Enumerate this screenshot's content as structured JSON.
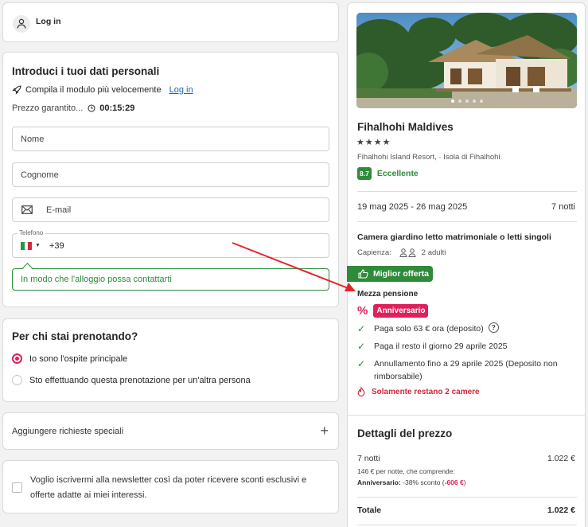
{
  "login": {
    "label": "Log in"
  },
  "personal": {
    "title": "Introduci i tuoi dati personali",
    "fast_text": "Compila il modulo più velocemente",
    "fast_link": "Log in",
    "guarantee_text": "Prezzo garantito...",
    "timer": "00:15:29",
    "name_placeholder": "Nome",
    "surname_placeholder": "Cognome",
    "email_placeholder": "E-mail",
    "phone_label": "Telefono",
    "phone_prefix": "+39",
    "phone_hint": "In modo che l'alloggio possa contattarti"
  },
  "booking_for": {
    "title": "Per chi stai prenotando?",
    "option_main": "Io sono l'ospite principale",
    "option_other": "Sto effettuando questa prenotazione per un'altra persona"
  },
  "special_requests": {
    "label": "Aggiungere richieste speciali"
  },
  "newsletter": {
    "text": "Voglio iscrivermi alla newsletter così da poter ricevere sconti esclusivi e offerte adatte ai miei interessi."
  },
  "hotel": {
    "name": "Fihalhohi Maldives",
    "stars": "★★★★",
    "location": "Fihalhohi Island Resort, · Isola di Fihalhohi",
    "score": "8.7",
    "rating_label": "Eccellente",
    "dates": "19 mag 2025 - 26 mag 2025",
    "nights": "7 notti",
    "room_title": "Camera giardino letto matrimoniale o letti singoli",
    "capacity_label": "Capienza:",
    "capacity_value": "2 adulti",
    "best_offer": "Miglior offerta",
    "board": "Mezza pensione",
    "promo": "Anniversario",
    "pay_now": "Paga solo 63 € ora (deposito)",
    "pay_rest": "Paga il resto il giorno 29 aprile 2025",
    "cancel": "Annullamento fino a 29 aprile 2025 (Deposito non rimborsabile)",
    "rooms_left": "Solamente restano 2 camere"
  },
  "price": {
    "title": "Dettagli del prezzo",
    "nights": "7 notti",
    "amount": "1.022 €",
    "per_night": "146 € per notte, che comprende:",
    "discount_label": "Anniversario:",
    "discount_text": "-38% sconto",
    "discount_value": "-606 €",
    "total_label": "Totale",
    "total_value": "1.022 €"
  },
  "colors": {
    "accent": "#e0205a",
    "green": "#2e8b3a",
    "link": "#1565c0",
    "warning": "#d0263a"
  }
}
